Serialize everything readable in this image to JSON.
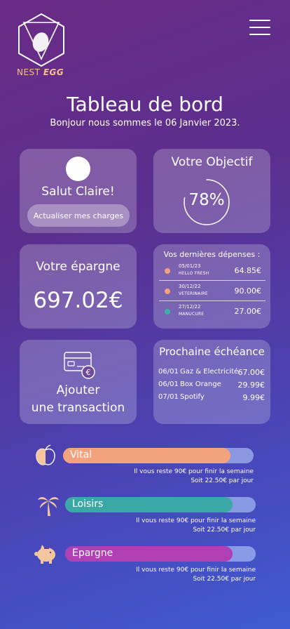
{
  "brand": {
    "name_prefix": "NEST",
    "name_suffix": "EGG"
  },
  "header": {
    "title": "Tableau de bord",
    "subtitle": "Bonjour nous sommes le 06 Janvier 2023."
  },
  "profile": {
    "greeting": "Salut Claire!",
    "update_button": "Actualiser mes charges"
  },
  "objective": {
    "title": "Votre Objectif",
    "value_label": "78%",
    "value": 0.78
  },
  "savings": {
    "title": "Votre épargne",
    "amount": "697.02€"
  },
  "expenses": {
    "title": "Vos dernières dépenses :",
    "items": [
      {
        "date": "05/01/23",
        "shop": "HELLO FRESH",
        "amount": "64.85€",
        "color": "#f4a27c"
      },
      {
        "date": "30/12/22",
        "shop": "VETERINAIRE",
        "amount": "90.00€",
        "color": "#f4a27c"
      },
      {
        "date": "27/12/22",
        "shop": "MANUCURE",
        "amount": "27.00€",
        "color": "#3fb0a8"
      }
    ]
  },
  "add_transaction": {
    "line1": "Ajouter",
    "line2": "une transaction"
  },
  "next_due": {
    "title": "Prochaine échéance",
    "items": [
      {
        "date": "06/01",
        "name": "Gaz & Electricité",
        "amount": "67.00€"
      },
      {
        "date": "06/01",
        "name": "Box Orange",
        "amount": "29.99€"
      },
      {
        "date": "07/01",
        "name": "Spotify",
        "amount": "9.99€"
      }
    ]
  },
  "budgets": [
    {
      "label": "Vital",
      "fill": 0.88,
      "color": "#f3a27e",
      "icon": "apple-icon",
      "note_line1": "Il vous reste 90€ pour finir la semaine",
      "note_line2": "Soit 22.50€ par jour"
    },
    {
      "label": "Loisirs",
      "fill": 0.88,
      "color": "#3aa9a6",
      "icon": "palm-tree-icon",
      "note_line1": "Il vous reste 90€ pour finir la semaine",
      "note_line2": "Soit 22.50€ par jour"
    },
    {
      "label": "Epargne",
      "fill": 0.88,
      "color": "#b03fb3",
      "icon": "piggy-bank-icon",
      "note_line1": "Il vous reste 90€ pour finir la semaine",
      "note_line2": "Soit 22.50€ par jour"
    }
  ]
}
